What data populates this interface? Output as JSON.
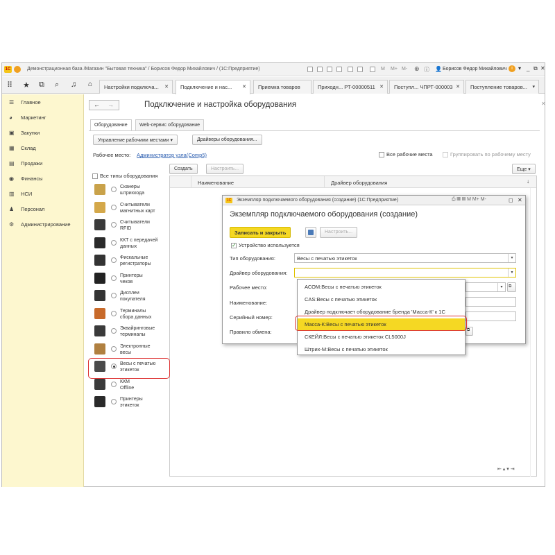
{
  "window": {
    "title": "Демонстрационная база /Магазин \"Бытовая техника\" / Борисов Федор Михайлович / (1С:Предприятие)",
    "user": "Борисов Федор Михайлович",
    "logo_text": "1С"
  },
  "tabs": [
    {
      "label": "Настройки подключа..."
    },
    {
      "label": "Подключение и нас..."
    },
    {
      "label": "Приемка товаров"
    },
    {
      "label": "Приходн... РТ-00000511"
    },
    {
      "label": "Поступл... ЧПРТ-000003"
    },
    {
      "label": "Поступление товаров..."
    }
  ],
  "sidebar": {
    "items": [
      {
        "label": "Главное",
        "icon": "menu-icon"
      },
      {
        "label": "Маркетинг",
        "icon": "marketing-icon"
      },
      {
        "label": "Закупки",
        "icon": "cart-icon"
      },
      {
        "label": "Склад",
        "icon": "warehouse-icon"
      },
      {
        "label": "Продажи",
        "icon": "sales-icon"
      },
      {
        "label": "Финансы",
        "icon": "finance-icon"
      },
      {
        "label": "НСИ",
        "icon": "catalog-icon"
      },
      {
        "label": "Персонал",
        "icon": "person-icon"
      },
      {
        "label": "Администрирование",
        "icon": "gear-icon"
      }
    ]
  },
  "page": {
    "title": "Подключение и настройка оборудования",
    "subtabs": [
      "Оборудование",
      "Web-сервис оборудование"
    ],
    "btn_workplaces": "Управление рабочими местами",
    "btn_drivers": "Драйверы оборудования...",
    "workplace_label": "Рабочее место:",
    "workplace_link": "Администратор узла(Comp5)",
    "all_workplaces": "Все рабочие места",
    "group_by_workplace": "Группировать по рабочему месту",
    "btn_create": "Создать",
    "btn_configure": "Настроить...",
    "btn_more": "Еще",
    "all_types": "Все типы оборудования",
    "col_name": "Наименование",
    "col_driver": "Драйвер оборудования",
    "sort_icon": "↓"
  },
  "equipment_types": [
    {
      "label1": "Сканеры",
      "label2": "штрихкода",
      "selected": false
    },
    {
      "label1": "Считыватели",
      "label2": "магнитных карт",
      "selected": false
    },
    {
      "label1": "Считыватели",
      "label2": "RFID",
      "selected": false
    },
    {
      "label1": "ККТ с передачей",
      "label2": "данных",
      "selected": false
    },
    {
      "label1": "Фискальные",
      "label2": "регистраторы",
      "selected": false
    },
    {
      "label1": "Принтеры",
      "label2": "чеков",
      "selected": false
    },
    {
      "label1": "Дисплеи",
      "label2": "покупателя",
      "selected": false
    },
    {
      "label1": "Терминалы",
      "label2": "сбора данных",
      "selected": false
    },
    {
      "label1": "Эквайринговые",
      "label2": "терминалы",
      "selected": false
    },
    {
      "label1": "Электронные",
      "label2": "весы",
      "selected": false
    },
    {
      "label1": "Весы с печатью",
      "label2": "этикеток",
      "selected": true
    },
    {
      "label1": "ККМ",
      "label2": "Offline",
      "selected": false
    },
    {
      "label1": "Принтеры",
      "label2": "этикеток",
      "selected": false
    }
  ],
  "modal": {
    "window_title": "Экземпляр подключаемого оборудования (создание) (1С:Предприятие)",
    "heading": "Экземпляр подключаемого оборудования (создание)",
    "btn_save_close": "Записать и закрыть",
    "btn_configure": "Настроить...",
    "in_use_label": "Устройство используется",
    "type_label": "Тип оборудования:",
    "type_value": "Весы с печатью этикеток",
    "driver_label": "Драйвер оборудования:",
    "driver_value": "",
    "workplace_label": "Рабочее место:",
    "name_label": "Наименование:",
    "serial_label": "Серийный номер:",
    "exchange_label": "Правило обмена:"
  },
  "driver_options": [
    {
      "label": "АСОМ:Весы с печатью этикеток",
      "selected": false
    },
    {
      "label": "CAS:Весы с печатью этикеток",
      "selected": false
    },
    {
      "label": "Драйвер подключает оборудование бренда 'Масса-К' к 1С",
      "selected": false
    },
    {
      "label": "Масса-К:Весы с печатью этикеток",
      "selected": true
    },
    {
      "label": "СКЕЙЛ:Весы с печатью этикеток CL5000J",
      "selected": false
    },
    {
      "label": "Штрих-М:Весы с печатью этикеток",
      "selected": false
    }
  ],
  "colors": {
    "accent_yellow": "#f5d823",
    "sidebar_bg": "#fdf7cf",
    "highlight_red": "#d33333"
  }
}
